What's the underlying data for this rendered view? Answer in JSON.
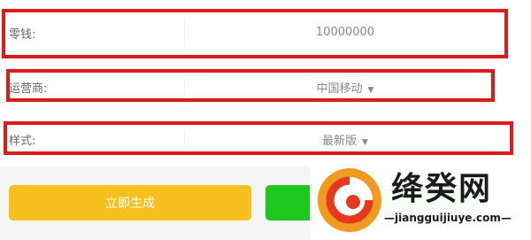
{
  "form": {
    "change": {
      "label": "零钱:",
      "value": "10000000"
    },
    "carrier": {
      "label": "运营商:",
      "value": "中国移动"
    },
    "style": {
      "label": "样式:",
      "value": "最新版"
    }
  },
  "caret_glyph": "▼",
  "buttons": {
    "generate_label": "立即生成",
    "generate_color": "#f7c01e",
    "secondary_color": "#1ec71e"
  },
  "highlight_color": "#dd1b1b",
  "watermark": {
    "title": "绛癸网",
    "url": "—jiangguijiuye.com—",
    "icon": "g-swirl-logo-icon"
  }
}
